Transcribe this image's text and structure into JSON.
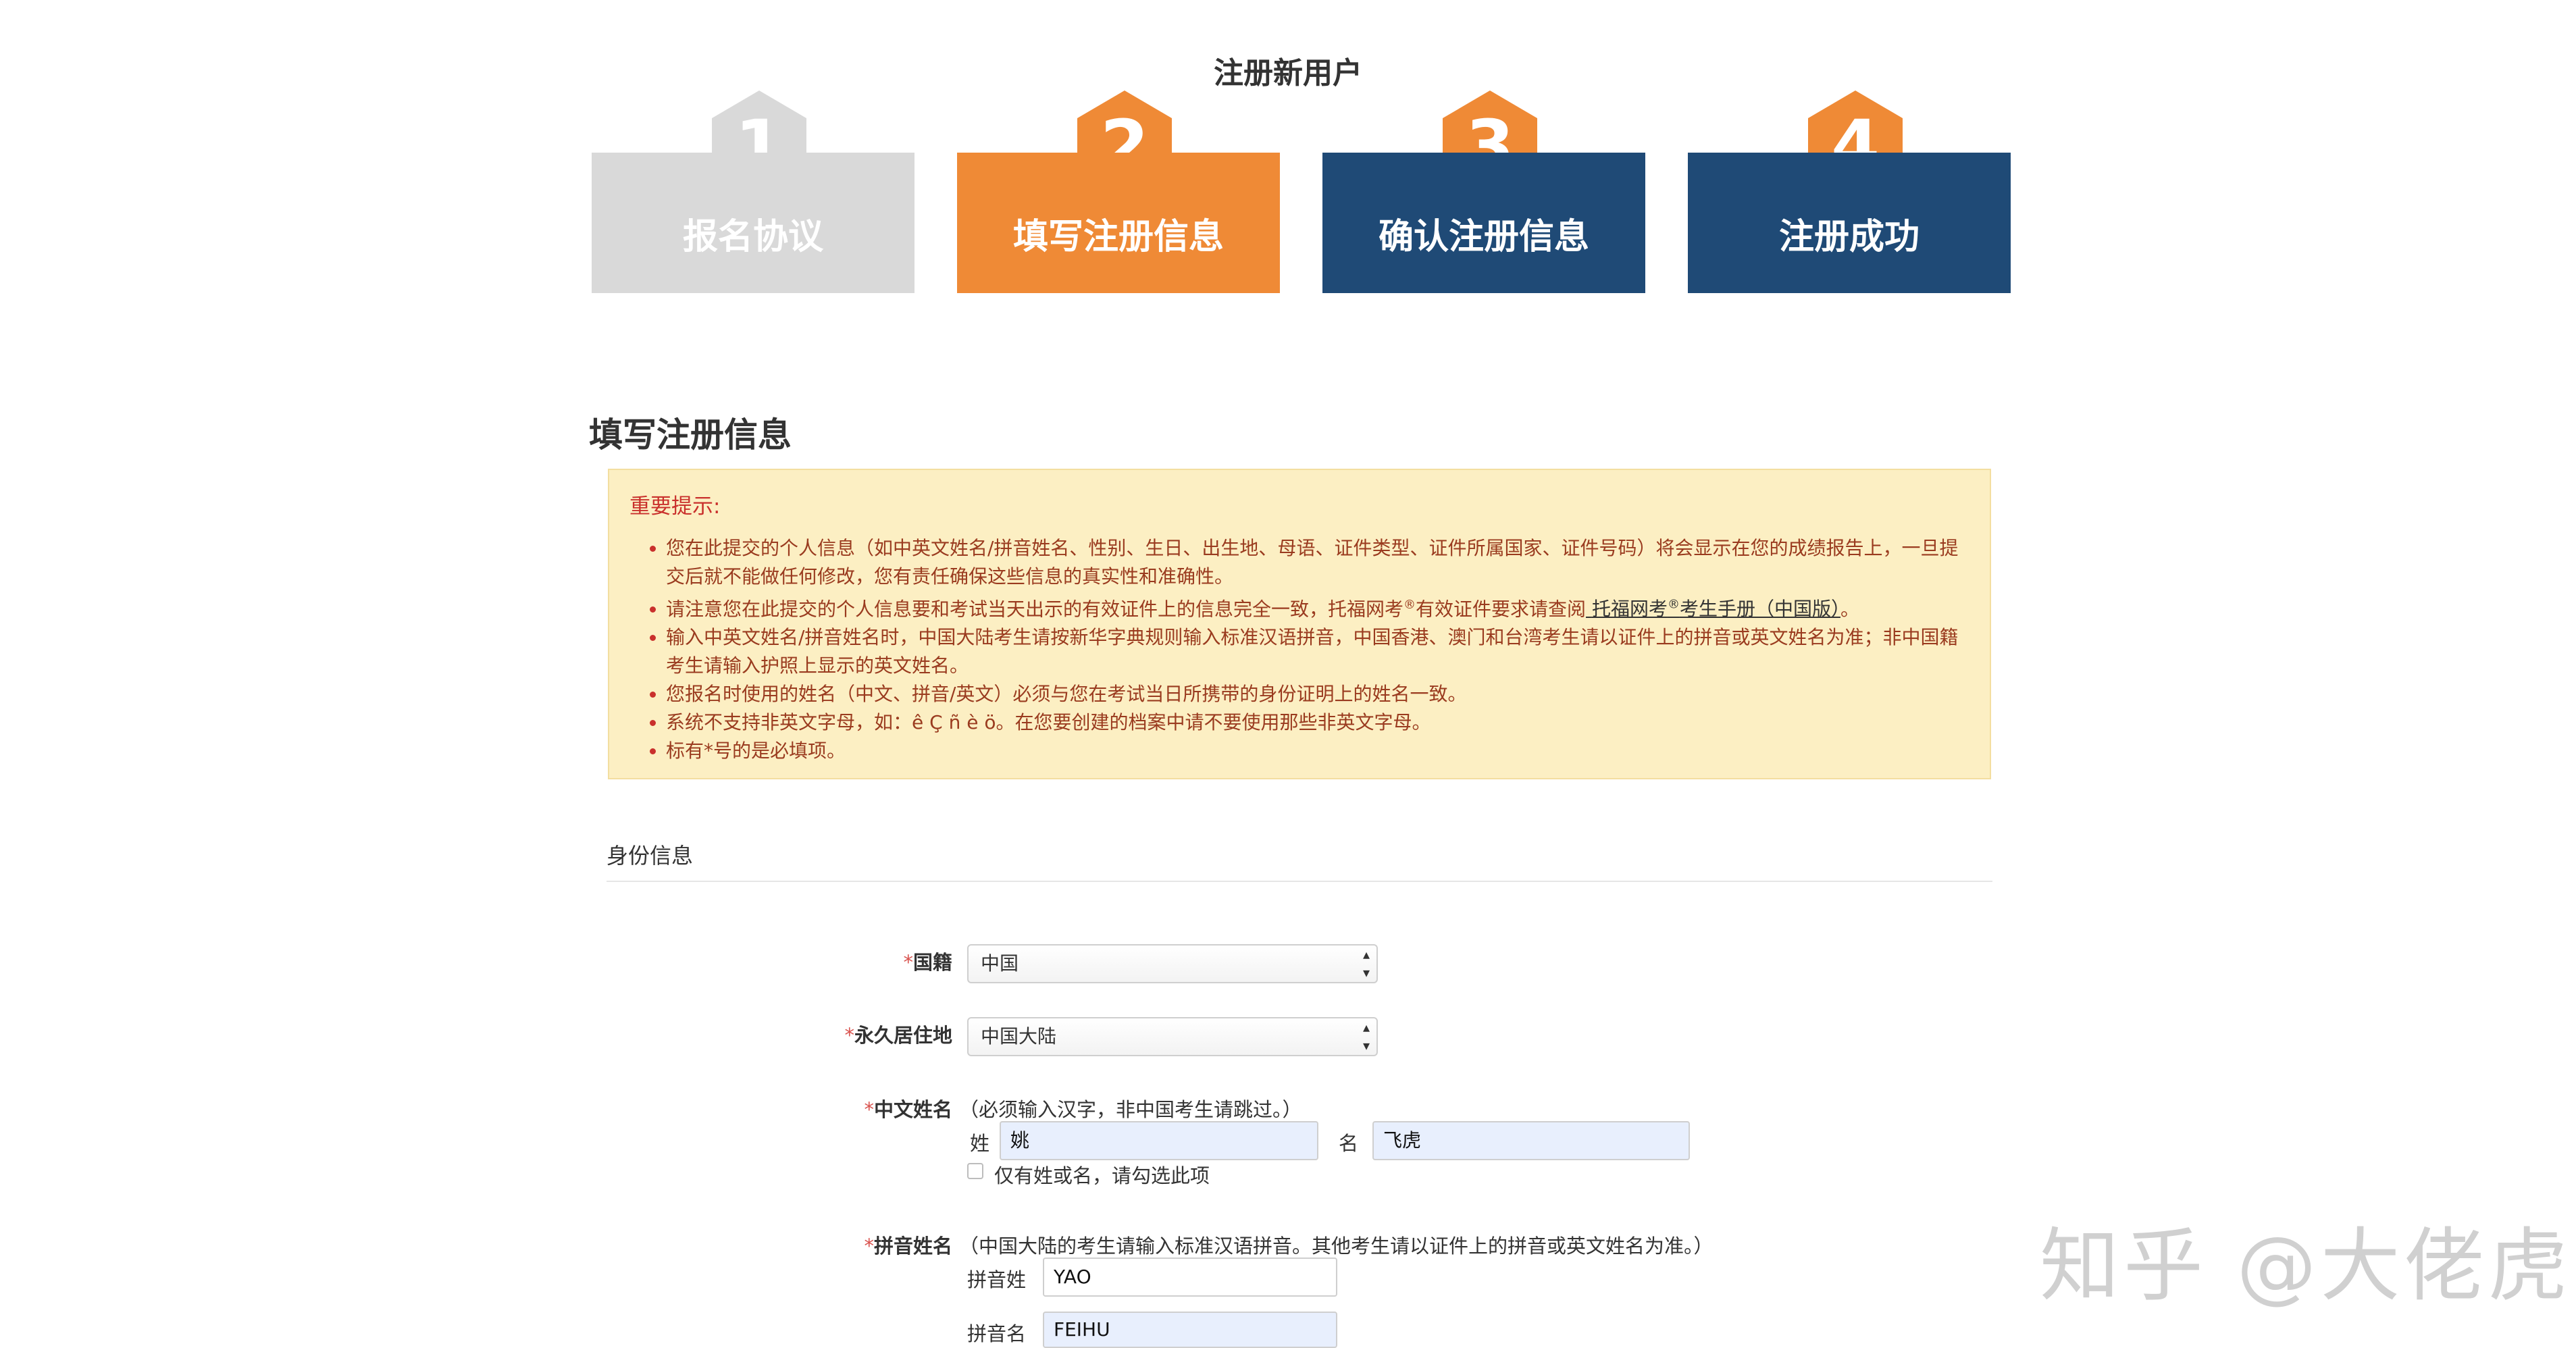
{
  "page": {
    "title": "注册新用户"
  },
  "steps": [
    {
      "number": "1",
      "label": "报名协议"
    },
    {
      "number": "2",
      "label": "填写注册信息"
    },
    {
      "number": "3",
      "label": "确认注册信息"
    },
    {
      "number": "4",
      "label": "注册成功"
    }
  ],
  "section_title": "填写注册信息",
  "notice": {
    "title": "重要提示:",
    "items": [
      "您在此提交的个人信息（如中英文姓名/拼音姓名、性别、生日、出生地、母语、证件类型、证件所属国家、证件号码）将会显示在您的成绩报告上，一旦提交后就不能做任何修改，您有责任确保这些信息的真实性和准确性。",
      "请注意您在此提交的个人信息要和考试当天出示的有效证件上的信息完全一致，托福网考",
      "输入中英文姓名/拼音姓名时，中国大陆考生请按新华字典规则输入标准汉语拼音，中国香港、澳门和台湾考生请以证件上的拼音或英文姓名为准；非中国籍考生请输入护照上显示的英文姓名。",
      "您报名时使用的姓名（中文、拼音/英文）必须与您在考试当日所携带的身份证明上的姓名一致。",
      "系统不支持非英文字母，如：ê Ç ñ è ö。在您要创建的档案中请不要使用那些非英文字母。",
      "标有*号的是必填项。"
    ],
    "item2_mid": "有效证件要求请查阅",
    "item2_link_a": "托福网考",
    "item2_link_b": "考生手册（中国版）",
    "item2_end": "。",
    "reg_mark": "®"
  },
  "subsection": "身份信息",
  "form": {
    "required_mark": "*",
    "nationality": {
      "label": "国籍",
      "value": "中国"
    },
    "residence": {
      "label": "永久居住地",
      "value": "中国大陆"
    },
    "chinese_name": {
      "label": "中文姓名",
      "hint": "（必须输入汉字，非中国考生请跳过。）",
      "surname_label": "姓",
      "surname_value": "姚",
      "given_label": "名",
      "given_value": "飞虎",
      "checkbox_label": "仅有姓或名，请勾选此项"
    },
    "pinyin_name": {
      "label": "拼音姓名",
      "hint": "（中国大陆的考生请输入标准汉语拼音。其他考生请以证件上的拼音或英文姓名为准。）",
      "surname_label": "拼音姓",
      "surname_value": "YAO",
      "given_label": "拼音名",
      "given_value": "FEIHU"
    }
  },
  "watermark": "知乎 @大佬虎",
  "icons": {
    "select_arrows": "up-down-caret-icon"
  },
  "colors": {
    "orange": "#ef8a36",
    "navy": "#1f4a76",
    "grey": "#d9d9d9",
    "notice_bg": "#fcefc3",
    "notice_text": "#9a3b1f",
    "required": "#d9534f"
  }
}
